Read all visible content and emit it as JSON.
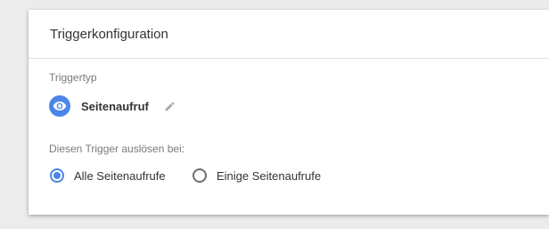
{
  "card": {
    "title": "Triggerkonfiguration"
  },
  "trigger_type": {
    "label": "Triggertyp",
    "name": "Seitenaufruf",
    "icon": "eye-icon",
    "edit_icon": "pencil-icon"
  },
  "fire_on": {
    "label": "Diesen Trigger auslösen bei:",
    "options": [
      {
        "label": "Alle Seitenaufrufe",
        "checked": true
      },
      {
        "label": "Einige Seitenaufrufe",
        "checked": false
      }
    ]
  },
  "colors": {
    "accent": "#4a86e8",
    "background": "#ececec",
    "card": "#ffffff"
  }
}
